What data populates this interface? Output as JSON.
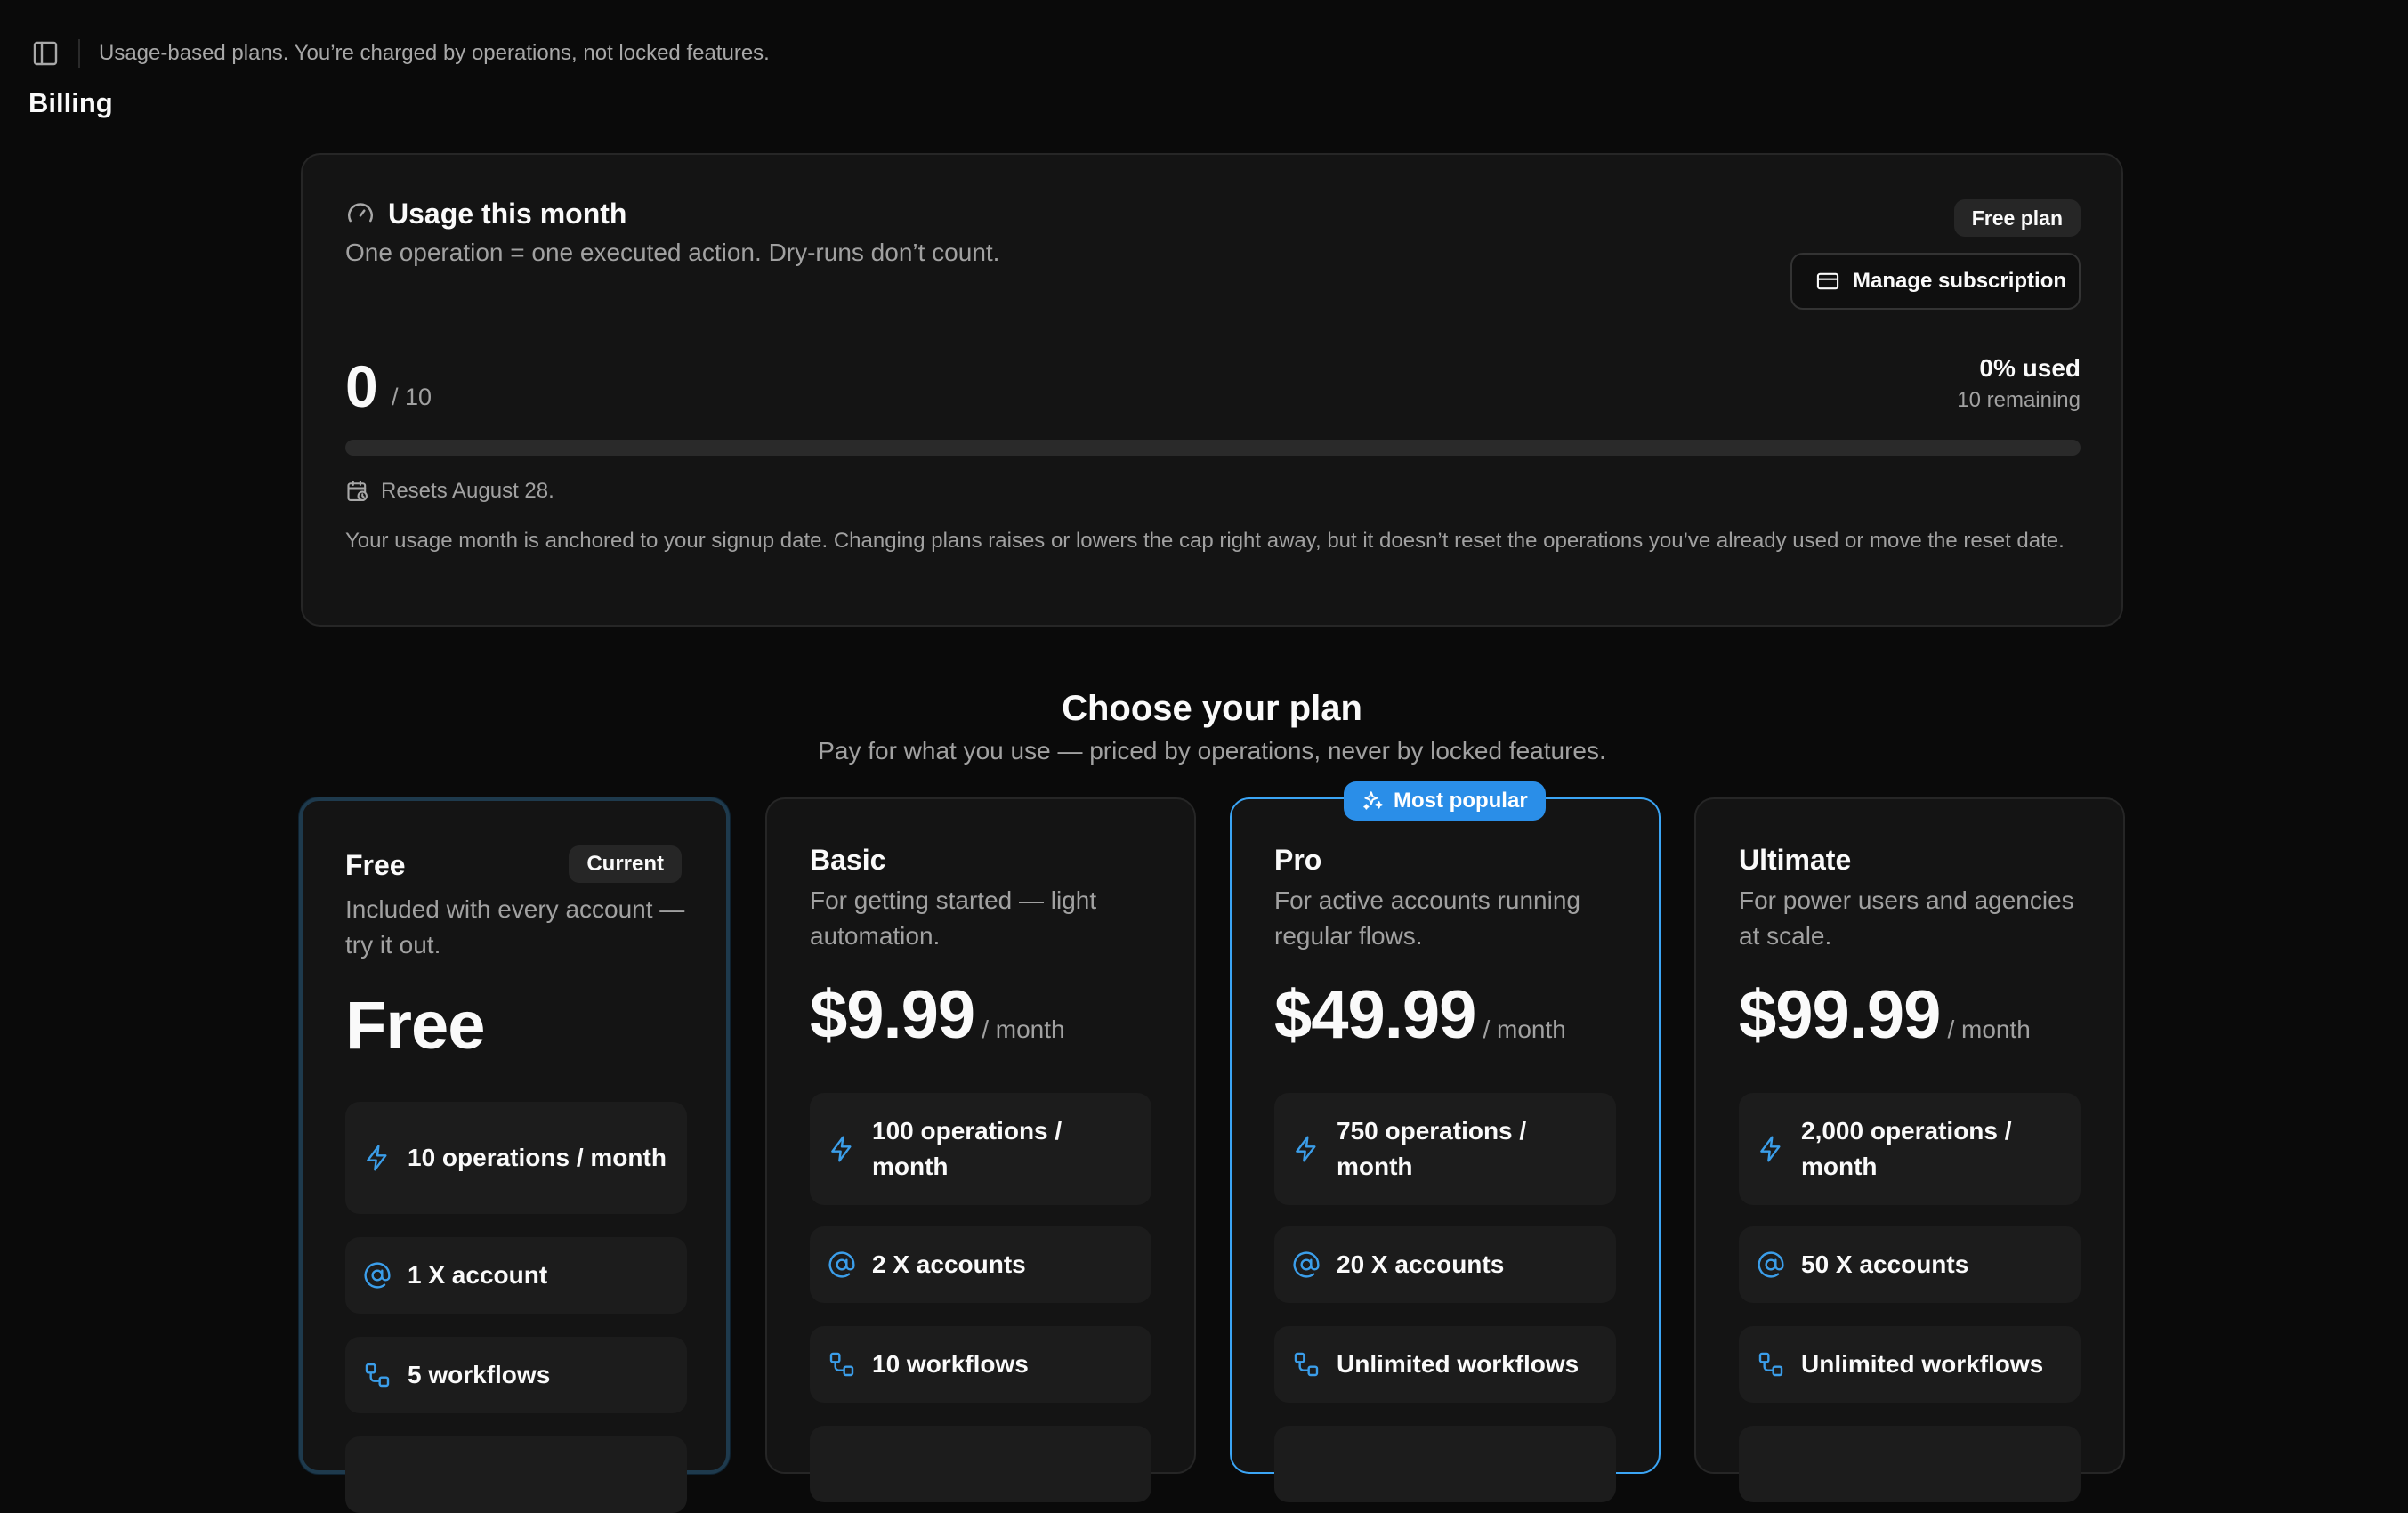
{
  "topbar": {
    "banner": "Usage-based plans. You’re charged by operations, not locked features."
  },
  "page": {
    "title": "Billing"
  },
  "usage": {
    "title": "Usage this month",
    "subtitle": "One operation = one executed action. Dry-runs don’t count.",
    "plan_badge": "Free plan",
    "manage_label": "Manage subscription",
    "used": "0",
    "cap": "/ 10",
    "percent_used": "0% used",
    "remaining": "10 remaining",
    "progress_fraction": 0,
    "reset_text": "Resets August 28.",
    "note": "Your usage month is anchored to your signup date. Changing plans raises or lowers the cap right away, but it doesn’t reset the operations you’ve already used or move the reset date."
  },
  "plans_section": {
    "title": "Choose your plan",
    "subtitle": "Pay for what you use — priced by operations, never by locked features.",
    "popular_label": "Most popular"
  },
  "plans": [
    {
      "name": "Free",
      "badge": "Current",
      "description": "Included with every account — try it out.",
      "price": "Free",
      "period": "",
      "operations": "10 operations / month",
      "accounts": "1 X account",
      "workflows": "5 workflows"
    },
    {
      "name": "Basic",
      "description": "For getting started — light automation.",
      "price": "$9.99",
      "period": "/ month",
      "operations": "100 operations / month",
      "accounts": "2 X accounts",
      "workflows": "10 workflows"
    },
    {
      "name": "Pro",
      "description": "For active accounts running regular flows.",
      "price": "$49.99",
      "period": "/ month",
      "operations": "750 operations / month",
      "accounts": "20 X accounts",
      "workflows": "Unlimited workflows"
    },
    {
      "name": "Ultimate",
      "description": "For power users and agencies at scale.",
      "price": "$99.99",
      "period": "/ month",
      "operations": "2,000 operations / month",
      "accounts": "50 X accounts",
      "workflows": "Unlimited workflows"
    }
  ],
  "colors": {
    "background": "#0a0a0a",
    "card": "#141414",
    "accent": "#3ba5f5",
    "icon_blue": "#3b9eea"
  },
  "icons": {
    "sidebar_toggle": "sidebar-toggle-icon",
    "usage": "gauge-icon",
    "manage": "credit-card-icon",
    "reset": "calendar-clock-icon",
    "popular": "sparkles-icon",
    "operations": "bolt-icon",
    "accounts": "at-sign-icon",
    "workflows": "workflow-icon"
  }
}
